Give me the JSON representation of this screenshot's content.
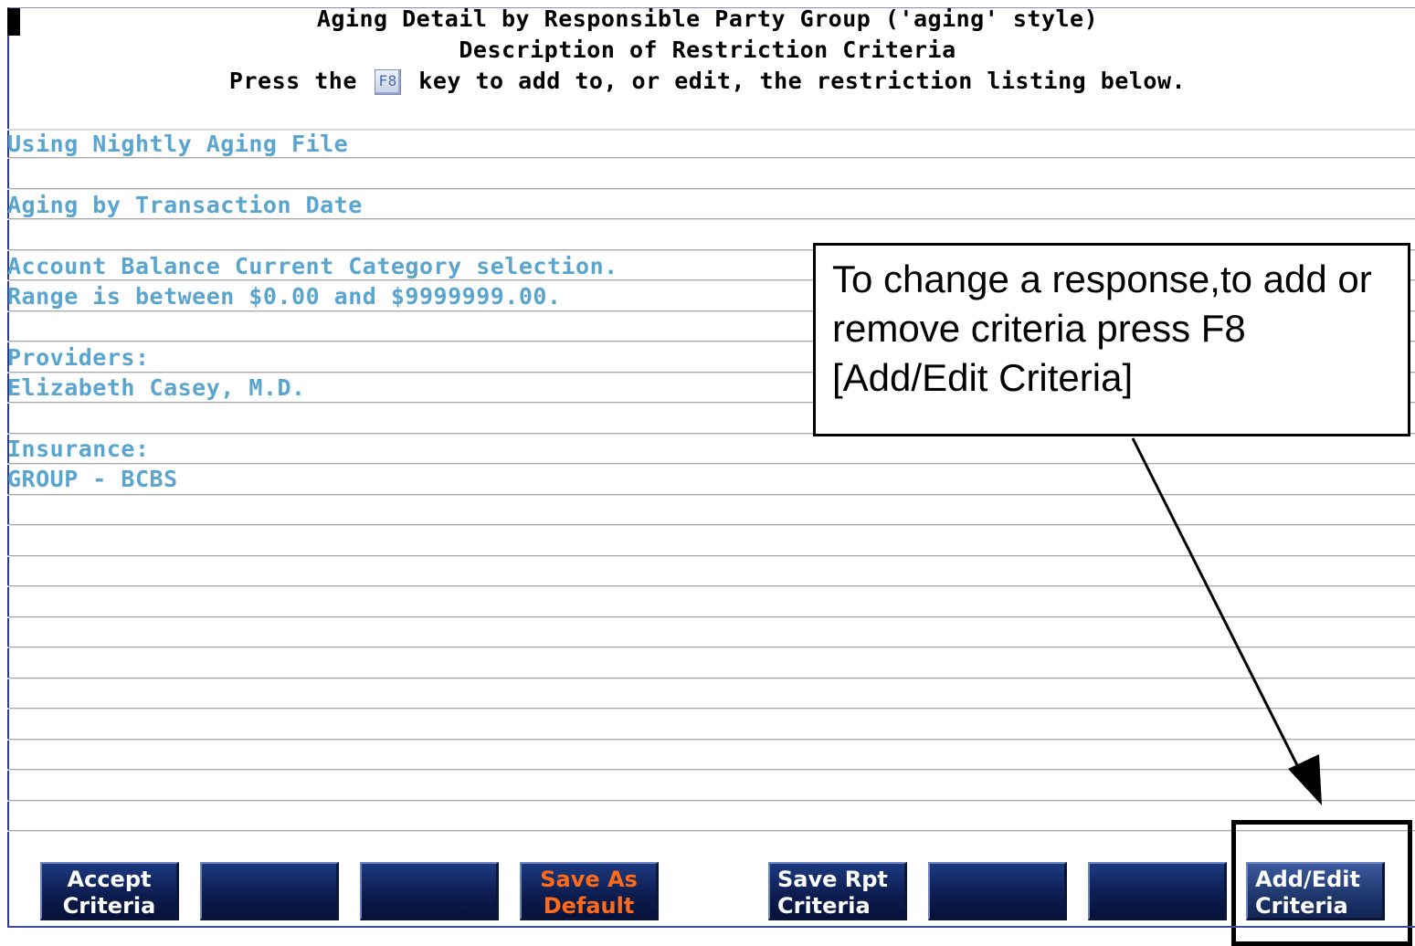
{
  "header": {
    "title": "Aging Detail by Responsible Party Group ('aging' style)",
    "subtitle": "Description of Restriction Criteria",
    "instruction_prefix": "Press the",
    "instruction_key": "F8",
    "instruction_suffix": "key to add to, or edit, the restriction listing below."
  },
  "criteria": [
    "Using Nightly Aging File",
    "Aging by Transaction Date",
    "Account Balance Current Category selection.",
    "Range is between $0.00 and $9999999.00.",
    "Providers:",
    "Elizabeth Casey, M.D.",
    "Insurance:",
    "GROUP - BCBS"
  ],
  "callout": {
    "text": "To change a response,to add or remove criteria press F8 [Add/Edit Criteria]"
  },
  "buttons": [
    {
      "line1": "Accept",
      "line2": "Criteria"
    },
    {
      "line1": "",
      "line2": ""
    },
    {
      "line1": "",
      "line2": ""
    },
    {
      "line1": "Save As",
      "line2": "Default"
    },
    {
      "line1": "Save Rpt",
      "line2": "Criteria"
    },
    {
      "line1": "",
      "line2": ""
    },
    {
      "line1": "",
      "line2": ""
    },
    {
      "line1": "Add/Edit",
      "line2": "Criteria"
    }
  ],
  "colors": {
    "criteria_text": "#5aa5d0",
    "button_bg": "#0e1e52",
    "orange_label": "#ff6a18"
  }
}
